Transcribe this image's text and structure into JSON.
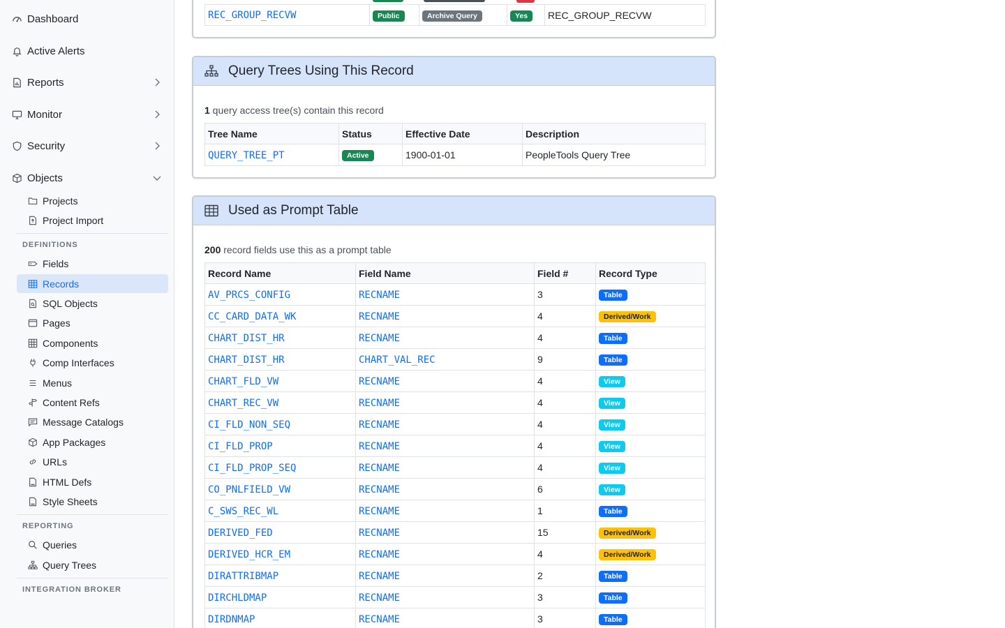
{
  "sidebar": {
    "top_items": [
      {
        "label": "Dashboard",
        "icon": "speedometer-icon"
      },
      {
        "label": "Active Alerts",
        "icon": "bell-icon"
      },
      {
        "label": "Reports",
        "icon": "report-icon"
      },
      {
        "label": "Monitor",
        "icon": "display-icon"
      },
      {
        "label": "Security",
        "icon": "shield-icon"
      },
      {
        "label": "Objects",
        "icon": "box-icon"
      }
    ],
    "object_items": [
      {
        "label": "Projects",
        "icon": "folder-icon"
      },
      {
        "label": "Project Import",
        "icon": "file-import-icon"
      }
    ],
    "definitions_header": "DEFINITIONS",
    "definition_items": [
      {
        "label": "Fields",
        "icon": "tag-icon"
      },
      {
        "label": "Records",
        "icon": "table-icon"
      },
      {
        "label": "SQL Objects",
        "icon": "file-code-icon"
      },
      {
        "label": "Pages",
        "icon": "window-icon"
      },
      {
        "label": "Components",
        "icon": "grid-icon"
      },
      {
        "label": "Comp Interfaces",
        "icon": "plug-icon"
      },
      {
        "label": "Menus",
        "icon": "list-icon"
      },
      {
        "label": "Content Refs",
        "icon": "signpost-icon"
      },
      {
        "label": "Message Catalogs",
        "icon": "message-icon"
      },
      {
        "label": "App Packages",
        "icon": "box-icon"
      },
      {
        "label": "URLs",
        "icon": "link-icon"
      },
      {
        "label": "HTML Defs",
        "icon": "html-file-icon"
      },
      {
        "label": "Style Sheets",
        "icon": "stylesheet-file-icon"
      }
    ],
    "reporting_header": "REPORTING",
    "reporting_items": [
      {
        "label": "Queries",
        "icon": "search-icon"
      },
      {
        "label": "Query Trees",
        "icon": "tree-icon"
      }
    ],
    "integration_header": "INTEGRATION BROKER"
  },
  "access_row": {
    "record": "REC_GROUP_RECVW",
    "badge1": "Public",
    "badge2": "Archive Query",
    "badge3": "Yes",
    "description": "REC_GROUP_RECVW"
  },
  "query_trees": {
    "title": "Query Trees Using This Record",
    "summary_count": "1",
    "summary_text": " query access tree(s) contain this record",
    "headers": [
      "Tree Name",
      "Status",
      "Effective Date",
      "Description"
    ],
    "rows": [
      {
        "name": "QUERY_TREE_PT",
        "status": "Active",
        "date": "1900-01-01",
        "description": "PeopleTools Query Tree"
      }
    ]
  },
  "prompt_table": {
    "title": "Used as Prompt Table",
    "summary_count": "200",
    "summary_text": " record fields use this as a prompt table",
    "headers": [
      "Record Name",
      "Field Name",
      "Field #",
      "Record Type"
    ],
    "rows": [
      {
        "record": "AV_PRCS_CONFIG",
        "field": "RECNAME",
        "num": "3",
        "type": "Table"
      },
      {
        "record": "CC_CARD_DATA_WK",
        "field": "RECNAME",
        "num": "4",
        "type": "Derived/Work"
      },
      {
        "record": "CHART_DIST_HR",
        "field": "RECNAME",
        "num": "4",
        "type": "Table"
      },
      {
        "record": "CHART_DIST_HR",
        "field": "CHART_VAL_REC",
        "num": "9",
        "type": "Table"
      },
      {
        "record": "CHART_FLD_VW",
        "field": "RECNAME",
        "num": "4",
        "type": "View"
      },
      {
        "record": "CHART_REC_VW",
        "field": "RECNAME",
        "num": "4",
        "type": "View"
      },
      {
        "record": "CI_FLD_NON_SEQ",
        "field": "RECNAME",
        "num": "4",
        "type": "View"
      },
      {
        "record": "CI_FLD_PROP",
        "field": "RECNAME",
        "num": "4",
        "type": "View"
      },
      {
        "record": "CI_FLD_PROP_SEQ",
        "field": "RECNAME",
        "num": "4",
        "type": "View"
      },
      {
        "record": "CO_PNLFIELD_VW",
        "field": "RECNAME",
        "num": "6",
        "type": "View"
      },
      {
        "record": "C_SWS_REC_WL",
        "field": "RECNAME",
        "num": "1",
        "type": "Table"
      },
      {
        "record": "DERIVED_FED",
        "field": "RECNAME",
        "num": "15",
        "type": "Derived/Work"
      },
      {
        "record": "DERIVED_HCR_EM",
        "field": "RECNAME",
        "num": "4",
        "type": "Derived/Work"
      },
      {
        "record": "DIRATTRIBMAP",
        "field": "RECNAME",
        "num": "2",
        "type": "Table"
      },
      {
        "record": "DIRCHLDMAP",
        "field": "RECNAME",
        "num": "3",
        "type": "Table"
      },
      {
        "record": "DIRDNMAP",
        "field": "RECNAME",
        "num": "3",
        "type": "Table"
      }
    ]
  }
}
